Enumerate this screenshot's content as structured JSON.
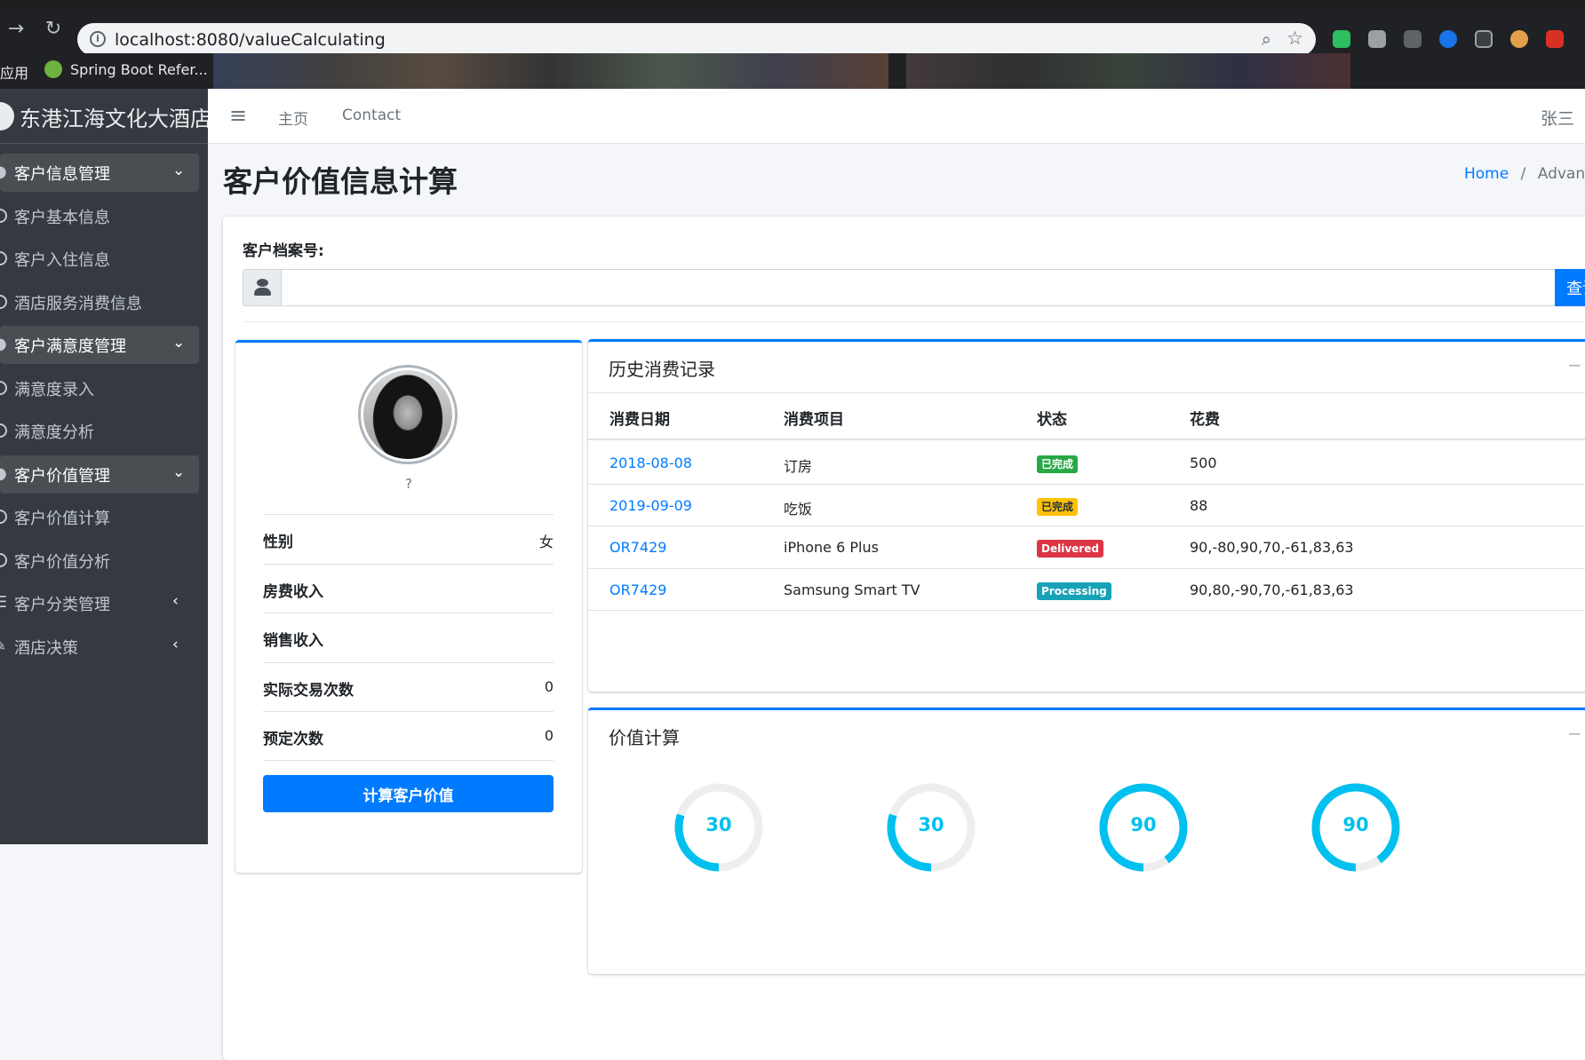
{
  "browser": {
    "url": "localhost:8080/valueCalculating",
    "bookmarks": [
      {
        "label": "应用"
      },
      {
        "label": "Spring Boot Refer..."
      }
    ]
  },
  "sidebar": {
    "brand": "东港江海文化大酒店",
    "items": [
      {
        "label": "客户信息管理",
        "type": "head",
        "icon": "users-icon",
        "arrow": "⌄"
      },
      {
        "label": "客户基本信息",
        "type": "sub",
        "icon": "circle-icon"
      },
      {
        "label": "客户入住信息",
        "type": "sub",
        "icon": "circle-icon"
      },
      {
        "label": "酒店服务消费信息",
        "type": "sub",
        "icon": "circle-icon"
      },
      {
        "label": "客户满意度管理",
        "type": "head",
        "icon": "smile-icon",
        "arrow": "⌄"
      },
      {
        "label": "满意度录入",
        "type": "sub",
        "icon": "circle-icon"
      },
      {
        "label": "满意度分析",
        "type": "sub",
        "icon": "circle-icon"
      },
      {
        "label": "客户价值管理",
        "type": "head",
        "icon": "dollar-icon",
        "arrow": "⌄"
      },
      {
        "label": "客户价值计算",
        "type": "sub",
        "icon": "circle-icon"
      },
      {
        "label": "客户价值分析",
        "type": "sub",
        "icon": "circle-icon"
      },
      {
        "label": "客户分类管理",
        "type": "plain",
        "icon": "list-icon",
        "arrow": "‹"
      },
      {
        "label": "酒店决策",
        "type": "plain",
        "icon": "pen-icon",
        "arrow": "‹"
      }
    ]
  },
  "navbar": {
    "home": "主页",
    "contact": "Contact",
    "user": "张三"
  },
  "page": {
    "title": "客户价值信息计算",
    "breadcrumb_home": "Home",
    "breadcrumb_sep": "/",
    "breadcrumb_current": "Advanced"
  },
  "search": {
    "label": "客户档案号:",
    "placeholder": "",
    "button": "查询"
  },
  "profile": {
    "name": "?",
    "rows": [
      {
        "key": "性别",
        "value": "女"
      },
      {
        "key": "房费收入",
        "value": ""
      },
      {
        "key": "销售收入",
        "value": ""
      },
      {
        "key": "实际交易次数",
        "value": "0"
      },
      {
        "key": "预定次数",
        "value": "0"
      }
    ],
    "button": "计算客户价值"
  },
  "history": {
    "title": "历史消费记录",
    "columns": [
      "消费日期",
      "消费项目",
      "状态",
      "花费"
    ],
    "rows": [
      {
        "date": "2018-08-08",
        "item": "订房",
        "status": "已完成",
        "status_color": "#28a745",
        "status_text_color": "#ffffff",
        "cost": "500"
      },
      {
        "date": "2019-09-09",
        "item": "吃饭",
        "status": "已完成",
        "status_color": "#ffc107",
        "status_text_color": "#1f2d3d",
        "cost": "88"
      },
      {
        "date": "OR7429",
        "item": "iPhone 6 Plus",
        "status": "Delivered",
        "status_color": "#dc3545",
        "status_text_color": "#ffffff",
        "cost": "90,-80,90,70,-61,83,63"
      },
      {
        "date": "OR7429",
        "item": "Samsung Smart TV",
        "status": "Processing",
        "status_color": "#17a2b8",
        "status_text_color": "#ffffff",
        "cost": "90,80,-90,70,-61,83,63"
      }
    ]
  },
  "value_calc": {
    "title": "价值计算",
    "gauges": [
      {
        "value": 30,
        "percent": 30,
        "color": "#00c0ef"
      },
      {
        "value": 30,
        "percent": 30,
        "color": "#00c0ef"
      },
      {
        "value": 90,
        "percent": 90,
        "color": "#00c0ef"
      },
      {
        "value": 90,
        "percent": 90,
        "color": "#00c0ef"
      }
    ]
  },
  "colors": {
    "primary": "#007bff",
    "sidebar_bg": "#343a40",
    "gauge_track": "#eeeeee"
  }
}
